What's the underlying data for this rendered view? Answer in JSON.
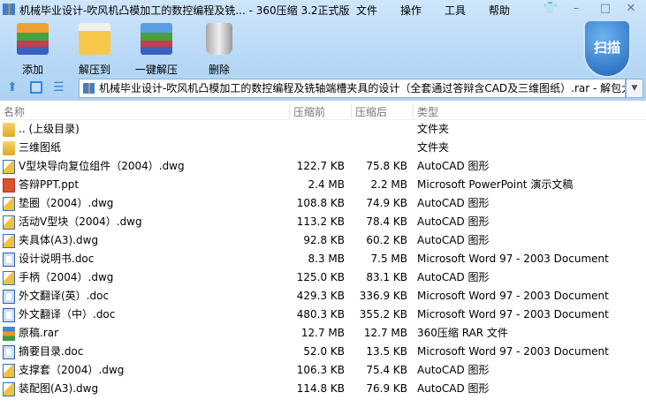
{
  "window": {
    "title": "机械毕业设计-吹风机凸模加工的数控编程及铣... - 360压缩 3.2正式版",
    "menus": [
      "文件",
      "操作",
      "工具",
      "帮助"
    ]
  },
  "toolbar": {
    "items": [
      {
        "label": "添加",
        "icon": "add-archive-icon"
      },
      {
        "label": "解压到",
        "icon": "extract-to-icon"
      },
      {
        "label": "一键解压",
        "icon": "one-click-extract-icon"
      },
      {
        "label": "删除",
        "icon": "delete-trash-icon"
      }
    ],
    "scan_label": "扫描"
  },
  "address": {
    "path": "机械毕业设计-吹风机凸模加工的数控编程及铣轴端槽夹具的设计（全套通过答辩含CAD及三维图纸）.rar - 解包大"
  },
  "columns": {
    "name": "名称",
    "before": "压缩前",
    "after": "压缩后",
    "type": "类型"
  },
  "files": [
    {
      "name": ".. (上级目录)",
      "before": "",
      "after": "",
      "type": "文件夹",
      "icon": "folder"
    },
    {
      "name": "三维图纸",
      "before": "",
      "after": "",
      "type": "文件夹",
      "icon": "folder"
    },
    {
      "name": "V型块导向复位组件（2004）.dwg",
      "before": "122.7 KB",
      "after": "75.8 KB",
      "type": "AutoCAD 图形",
      "icon": "dwg"
    },
    {
      "name": "答辩PPT.ppt",
      "before": "2.4 MB",
      "after": "2.2 MB",
      "type": "Microsoft PowerPoint 演示文稿",
      "icon": "ppt"
    },
    {
      "name": "垫圈（2004）.dwg",
      "before": "108.8 KB",
      "after": "74.9 KB",
      "type": "AutoCAD 图形",
      "icon": "dwg"
    },
    {
      "name": "活动V型块（2004）.dwg",
      "before": "113.2 KB",
      "after": "78.4 KB",
      "type": "AutoCAD 图形",
      "icon": "dwg"
    },
    {
      "name": "夹具体(A3).dwg",
      "before": "92.8 KB",
      "after": "60.2 KB",
      "type": "AutoCAD 图形",
      "icon": "dwg"
    },
    {
      "name": "设计说明书.doc",
      "before": "8.3 MB",
      "after": "7.5 MB",
      "type": "Microsoft Word 97 - 2003 Document",
      "icon": "doc"
    },
    {
      "name": "手柄（2004）.dwg",
      "before": "125.0 KB",
      "after": "83.1 KB",
      "type": "AutoCAD 图形",
      "icon": "dwg"
    },
    {
      "name": "外文翻译(英）.doc",
      "before": "429.3 KB",
      "after": "336.9 KB",
      "type": "Microsoft Word 97 - 2003 Document",
      "icon": "doc"
    },
    {
      "name": "外文翻译（中）.doc",
      "before": "480.3 KB",
      "after": "355.2 KB",
      "type": "Microsoft Word 97 - 2003 Document",
      "icon": "doc"
    },
    {
      "name": "原稿.rar",
      "before": "12.7 MB",
      "after": "12.7 MB",
      "type": "360压缩 RAR 文件",
      "icon": "rar"
    },
    {
      "name": "摘要目录.doc",
      "before": "52.0 KB",
      "after": "13.5 KB",
      "type": "Microsoft Word 97 - 2003 Document",
      "icon": "doc"
    },
    {
      "name": "支撑套（2004）.dwg",
      "before": "106.3 KB",
      "after": "75.4 KB",
      "type": "AutoCAD 图形",
      "icon": "dwg"
    },
    {
      "name": "装配图(A3).dwg",
      "before": "114.8 KB",
      "after": "76.9 KB",
      "type": "AutoCAD 图形",
      "icon": "dwg"
    }
  ]
}
